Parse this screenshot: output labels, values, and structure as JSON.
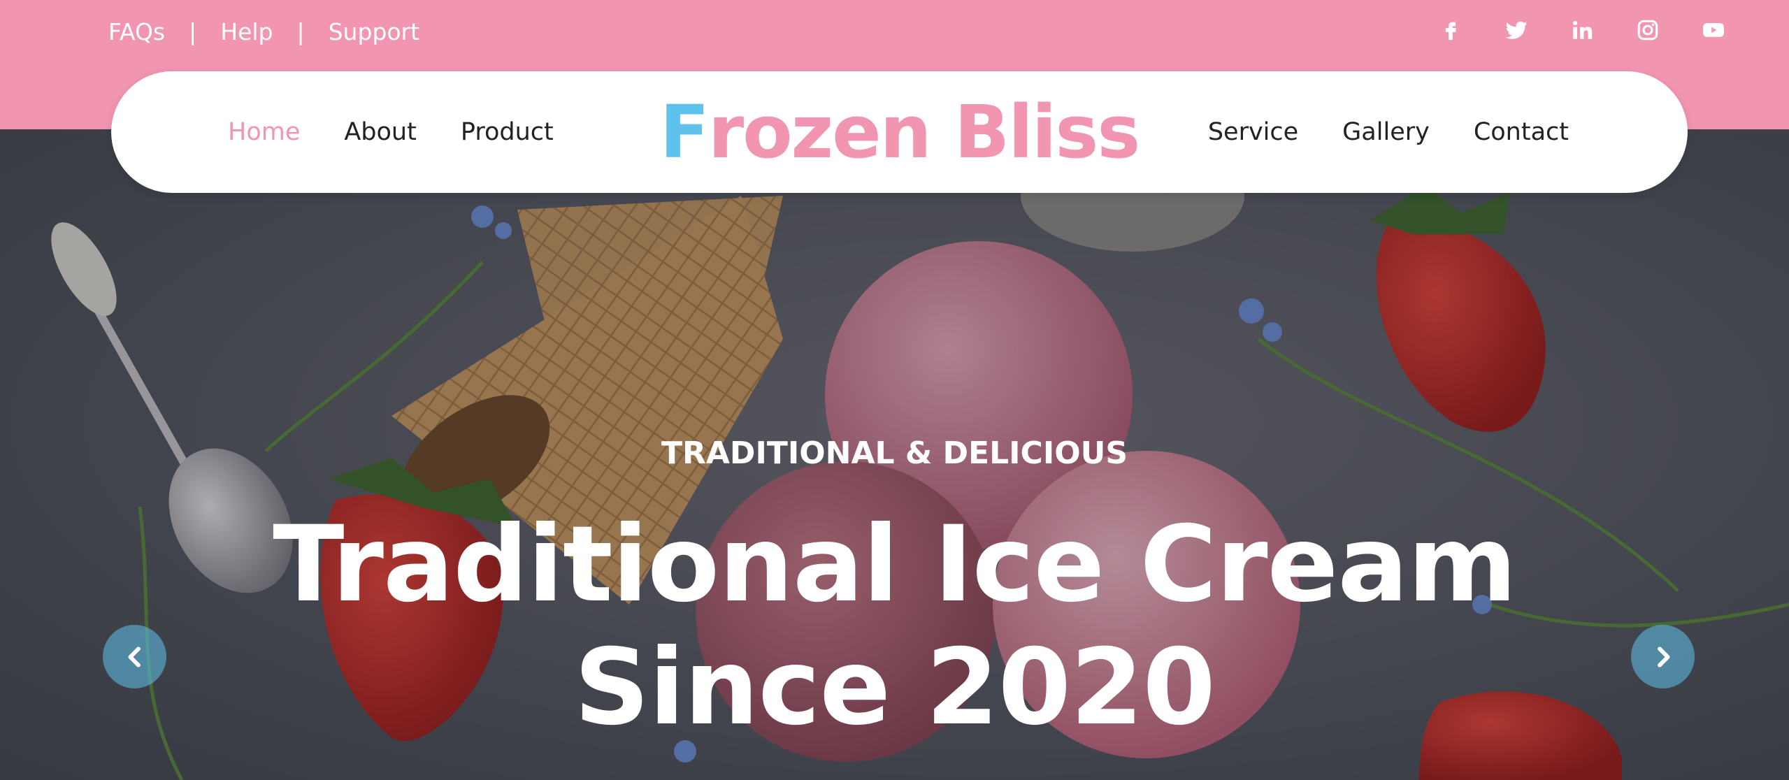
{
  "topbar": {
    "links": [
      "FAQs",
      "Help",
      "Support"
    ],
    "separator": "|",
    "social_icons": [
      "facebook-icon",
      "twitter-icon",
      "linkedin-icon",
      "instagram-icon",
      "youtube-icon"
    ]
  },
  "nav": {
    "left_items": [
      "Home",
      "About",
      "Product"
    ],
    "right_items": [
      "Service",
      "Gallery",
      "Contact"
    ],
    "active": "Home",
    "brand_part1": "F",
    "brand_part2": "rozen Bliss"
  },
  "hero": {
    "eyebrow": "TRADITIONAL & DELICIOUS",
    "headline_line1": "Traditional Ice Cream",
    "headline_line2": "Since 2020",
    "prev_icon": "chevron-left-icon",
    "next_icon": "chevron-right-icon"
  },
  "colors": {
    "pink": "#f195b1",
    "blue": "#5ec2ec",
    "white": "#ffffff"
  }
}
